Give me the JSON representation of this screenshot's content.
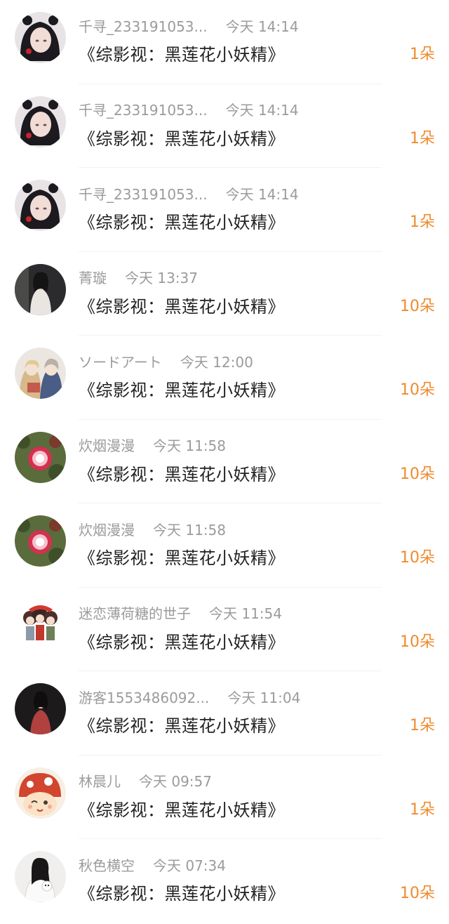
{
  "accent_color": "#f08a2e",
  "rows": [
    {
      "user": "千寻_233191053...",
      "time": "今天 14:14",
      "title": "《综影视：黑莲花小妖精》",
      "count": "1朵",
      "avatar": "anime-girl-avatar"
    },
    {
      "user": "千寻_233191053...",
      "time": "今天 14:14",
      "title": "《综影视：黑莲花小妖精》",
      "count": "1朵",
      "avatar": "anime-girl-avatar"
    },
    {
      "user": "千寻_233191053...",
      "time": "今天 14:14",
      "title": "《综影视：黑莲花小妖精》",
      "count": "1朵",
      "avatar": "anime-girl-avatar"
    },
    {
      "user": "菁璇",
      "time": "今天 13:37",
      "title": "《综影视：黑莲花小妖精》",
      "count": "10朵",
      "avatar": "photo-woman-avatar"
    },
    {
      "user": "ソードアート",
      "time": "今天 12:00",
      "title": "《综影视：黑莲花小妖精》",
      "count": "10朵",
      "avatar": "anime-duo-avatar"
    },
    {
      "user": "炊烟漫漫",
      "time": "今天 11:58",
      "title": "《综影视：黑莲花小妖精》",
      "count": "10朵",
      "avatar": "flower-avatar"
    },
    {
      "user": "炊烟漫漫",
      "time": "今天 11:58",
      "title": "《综影视：黑莲花小妖精》",
      "count": "10朵",
      "avatar": "flower-avatar"
    },
    {
      "user": "迷恋薄荷糖的世子",
      "time": "今天 11:54",
      "title": "《综影视：黑莲花小妖精》",
      "count": "10朵",
      "avatar": "chibi-group-avatar"
    },
    {
      "user": "游客1553486092...",
      "time": "今天 11:04",
      "title": "《综影视：黑莲花小妖精》",
      "count": "1朵",
      "avatar": "photo-dark-avatar"
    },
    {
      "user": "林晨儿",
      "time": "今天 09:57",
      "title": "《综影视：黑莲花小妖精》",
      "count": "1朵",
      "avatar": "cartoon-mushroom-avatar"
    },
    {
      "user": "秋色横空",
      "time": "今天 07:34",
      "title": "《综影视：黑莲花小妖精》",
      "count": "10朵",
      "avatar": "photo-white-avatar"
    }
  ]
}
